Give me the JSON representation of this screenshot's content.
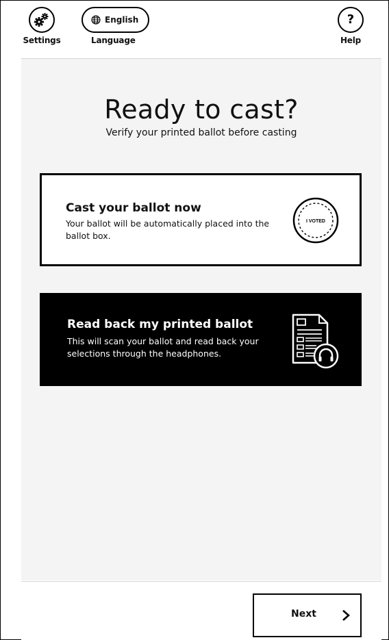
{
  "header": {
    "settings_label": "Settings",
    "language_button_text": "English",
    "language_label": "Language",
    "help_symbol": "?",
    "help_label": "Help"
  },
  "main": {
    "title": "Ready to cast?",
    "subtitle": "Verify your printed ballot before casting",
    "options": [
      {
        "title": "Cast your ballot now",
        "description": "Your ballot will be automatically placed into the ballot box.",
        "icon": "i-voted-sticker-icon",
        "icon_text": "I VOTED",
        "style": "outlined"
      },
      {
        "title": "Read back my printed ballot",
        "description": "This will scan your ballot and read back your selections through the headphones.",
        "icon": "ballot-headphones-icon",
        "style": "filled"
      }
    ]
  },
  "footer": {
    "next_label": "Next",
    "next_icon": "chevron-right-icon"
  },
  "colors": {
    "panel_background": "#f4f4f4",
    "primary": "#000000",
    "surface": "#ffffff"
  }
}
